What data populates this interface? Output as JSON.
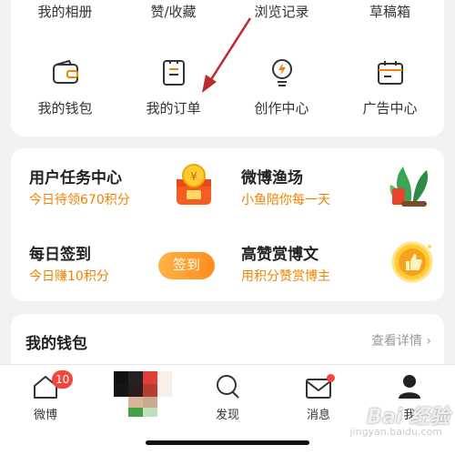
{
  "menu": {
    "row1": [
      "我的相册",
      "赞/收藏",
      "浏览记录",
      "草稿箱"
    ],
    "row2": [
      {
        "label": "我的钱包",
        "icon": "wallet-icon"
      },
      {
        "label": "我的订单",
        "icon": "order-list-icon"
      },
      {
        "label": "创作中心",
        "icon": "lightbulb-icon"
      },
      {
        "label": "广告中心",
        "icon": "calendar-ad-icon"
      }
    ]
  },
  "tasks": [
    {
      "title": "用户任务中心",
      "subtitle": "今日待领670积分",
      "icon": "gift-coin-box-icon"
    },
    {
      "title": "微博渔场",
      "subtitle": "小鱼陪你每一天",
      "icon": "fish-pond-icon"
    },
    {
      "title": "每日签到",
      "subtitle": "今日赚10积分",
      "button": "签到"
    },
    {
      "title": "高赞赏博文",
      "subtitle": "用积分赞赏博主",
      "icon": "gold-thumb-coin-icon"
    }
  ],
  "wallet": {
    "title": "我的钱包",
    "more": "查看详情"
  },
  "tabbar": [
    {
      "label": "微博",
      "icon": "home-icon",
      "badge": "10"
    },
    {
      "label": "发现",
      "icon": "search-icon"
    },
    {
      "label": "消息",
      "icon": "mail-icon"
    },
    {
      "label": "我",
      "icon": "person-icon"
    }
  ],
  "colors": {
    "accent": "#f08300",
    "badge": "#f5463c",
    "background": "#f2f2f2"
  },
  "watermark": {
    "text": "Bai 经验",
    "sub": "jingyan.baidu.com"
  }
}
